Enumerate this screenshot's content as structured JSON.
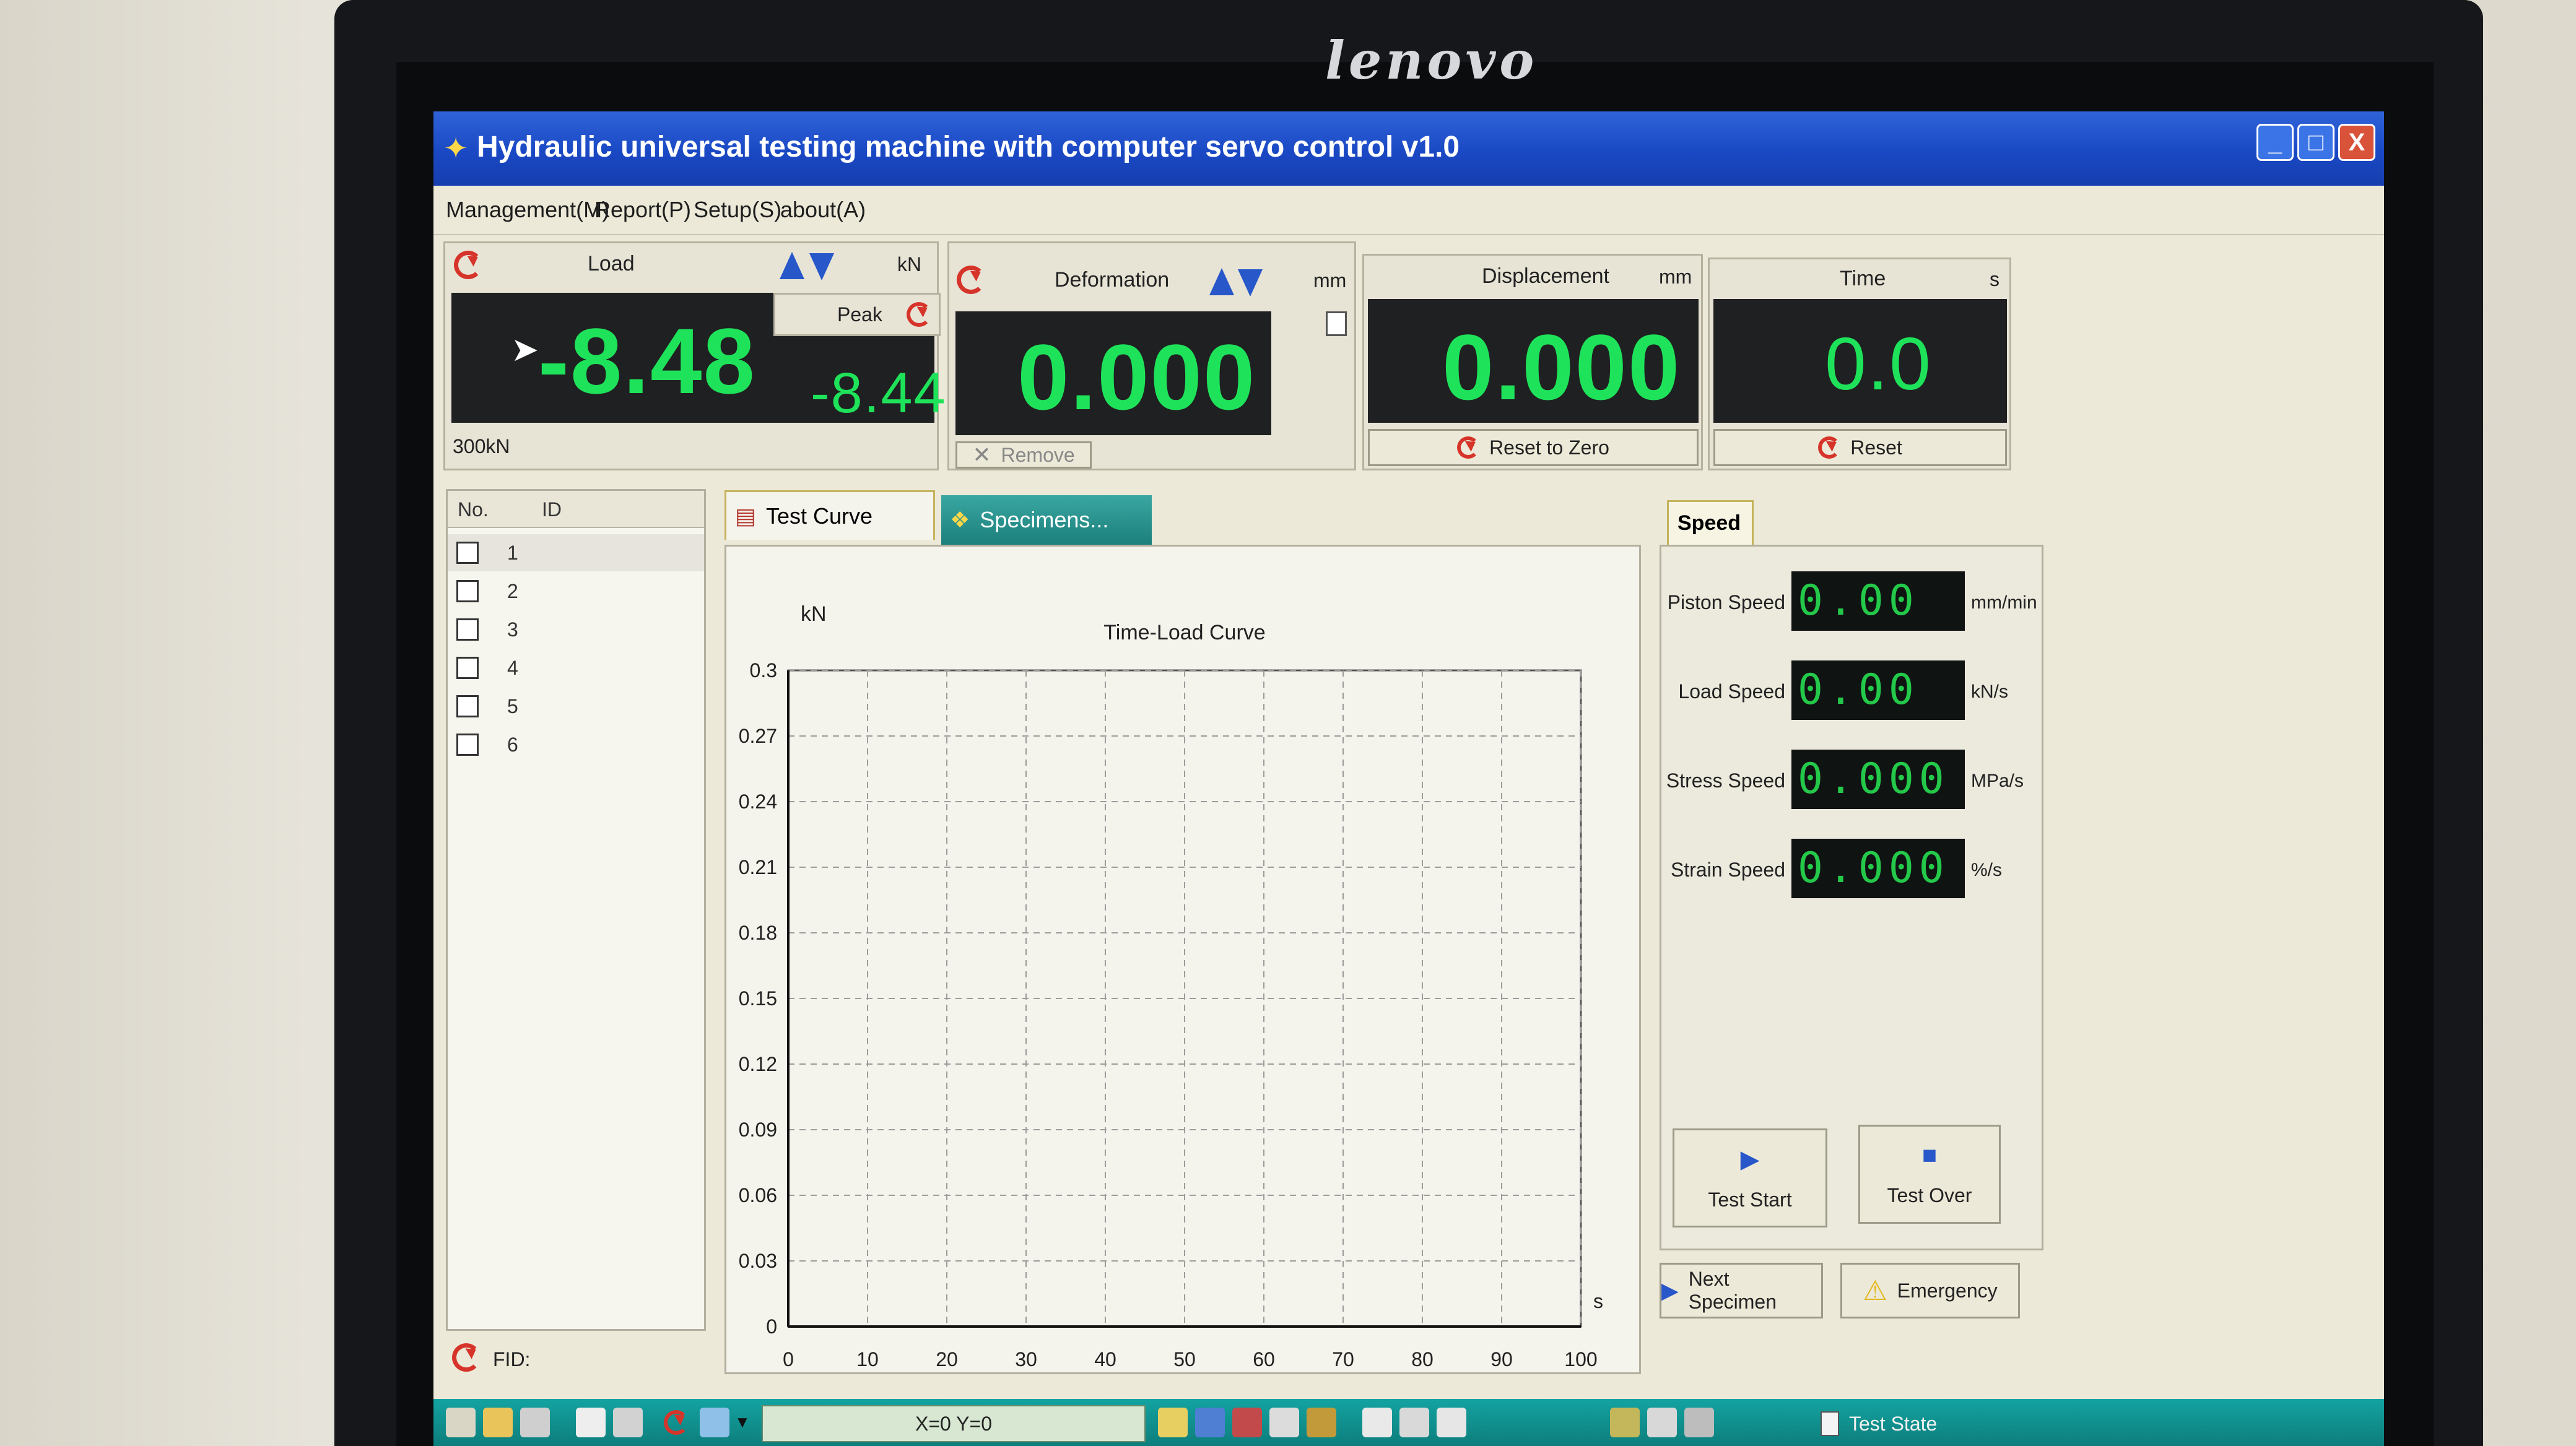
{
  "monitor": {
    "brand": "lenovo"
  },
  "window": {
    "title": "Hydraulic universal testing machine with computer servo control v1.0",
    "controls": {
      "minimize": "_",
      "maximize": "□",
      "close": "X"
    }
  },
  "menu": [
    "Management(M)",
    "Report(P)",
    "Setup(S)",
    "about(A)"
  ],
  "load": {
    "label": "Load",
    "unit": "kN",
    "value": "-8.48",
    "peak_label": "Peak",
    "peak_value": "-8.44",
    "range": "300kN"
  },
  "deformation": {
    "label": "Deformation",
    "unit": "mm",
    "value": "0.000",
    "remove_label": "Remove"
  },
  "displacement": {
    "label": "Displacement",
    "unit": "mm",
    "value": "0.000",
    "reset_label": "Reset to Zero"
  },
  "time": {
    "label": "Time",
    "unit": "s",
    "value": "0.0",
    "reset_label": "Reset"
  },
  "specimen_list": {
    "headers": [
      "No.",
      "ID"
    ],
    "rows": [
      "1",
      "2",
      "3",
      "4",
      "5",
      "6"
    ],
    "fid_label": "FID:"
  },
  "tabs": {
    "test_curve": "Test Curve",
    "specimens": "Specimens..."
  },
  "speed": {
    "tab_label": "Speed",
    "rows": [
      {
        "label": "Piston Speed",
        "value": "0.00",
        "unit": "mm/min"
      },
      {
        "label": "Load Speed",
        "value": "0.00",
        "unit": "kN/s"
      },
      {
        "label": "Stress Speed",
        "value": "0.000",
        "unit": "MPa/s"
      },
      {
        "label": "Strain Speed",
        "value": "0.000",
        "unit": "%/s"
      }
    ]
  },
  "buttons": {
    "test_start": "Test Start",
    "test_over": "Test Over",
    "next_specimen": "Next Specimen",
    "emergency": "Emergency"
  },
  "status": {
    "coords": "X=0  Y=0",
    "test_state": "Test State"
  },
  "chart_data": {
    "type": "line",
    "title": "Time-Load Curve",
    "ylabel": "kN",
    "xlabel": "s",
    "x_ticks": [
      0,
      10,
      20,
      30,
      40,
      50,
      60,
      70,
      80,
      90,
      100
    ],
    "y_ticks": [
      0,
      0.03,
      0.06,
      0.09,
      0.12,
      0.15,
      0.18,
      0.21,
      0.24,
      0.27,
      0.3
    ],
    "xlim": [
      0,
      100
    ],
    "ylim": [
      0,
      0.3
    ],
    "grid": true,
    "series": []
  },
  "colors": {
    "lcd_green": "#1ee35a",
    "accent_red": "#d6342a",
    "arrow_blue": "#2857c9"
  }
}
